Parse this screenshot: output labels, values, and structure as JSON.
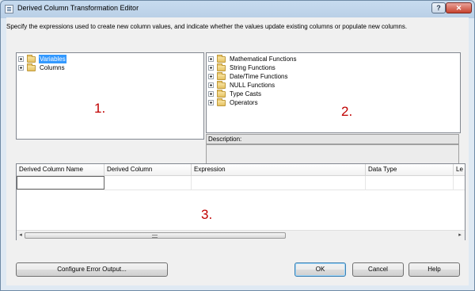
{
  "window": {
    "title": "Derived Column Transformation Editor",
    "help_glyph": "?",
    "close_glyph": "✕"
  },
  "instructions": "Specify the expressions used to create new column values, and indicate whether the values update existing columns or populate new columns.",
  "left_tree": {
    "items": [
      {
        "label": "Variables",
        "selected": true
      },
      {
        "label": "Columns",
        "selected": false
      }
    ],
    "annotation": "1."
  },
  "right_tree": {
    "items": [
      {
        "label": "Mathematical Functions"
      },
      {
        "label": "String Functions"
      },
      {
        "label": "Date/Time Functions"
      },
      {
        "label": "NULL Functions"
      },
      {
        "label": "Type Casts"
      },
      {
        "label": "Operators"
      }
    ],
    "annotation": "2."
  },
  "description": {
    "label": "Description:"
  },
  "grid": {
    "columns": [
      "Derived Column Name",
      "Derived Column",
      "Expression",
      "Data Type",
      "Le"
    ],
    "annotation": "3.",
    "scroll_left": "◂",
    "scroll_right": "▸"
  },
  "buttons": {
    "configure_error_output": "Configure Error Output...",
    "ok": "OK",
    "cancel": "Cancel",
    "help": "Help"
  },
  "colors": {
    "selection": "#3399ff",
    "annotation": "#c00000"
  }
}
